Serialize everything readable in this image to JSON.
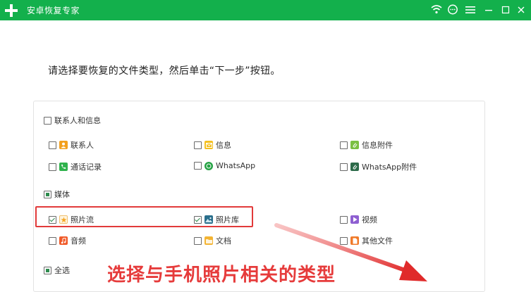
{
  "window": {
    "title": "安卓恢复专家",
    "brand_color": "#13b04c"
  },
  "instruction": "请选择要恢复的文件类型，然后单击“下一步”按钮。",
  "categories": {
    "contacts_messages": {
      "label": "联系人和信息",
      "items": {
        "contacts": "联系人",
        "messages": "信息",
        "message_attachments": "信息附件",
        "call_logs": "通话记录",
        "whatsapp": "WhatsApp",
        "whatsapp_attachments": "WhatsApp附件"
      }
    },
    "media": {
      "label": "媒体",
      "items": {
        "photo_stream": "照片流",
        "photo_library": "照片库",
        "video": "视频",
        "audio": "音频",
        "documents": "文档",
        "other_files": "其他文件"
      }
    },
    "select_all": "全选"
  },
  "annotation": "选择与手机照片相关的类型"
}
